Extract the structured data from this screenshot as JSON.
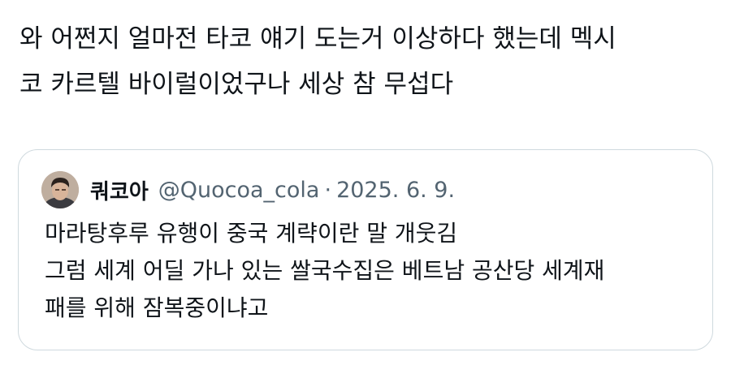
{
  "tweet": {
    "text": "와 어쩐지 얼마전 타코 얘기 도는거 이상하다 했는데 멕시\n코 카르텔 바이럴이었구나 세상 참 무섭다"
  },
  "quote": {
    "author_name": "쿼코아",
    "handle": "@Quocoa_cola",
    "separator": "·",
    "date": "2025. 6. 9.",
    "text": "마라탕후루 유행이 중국 계략이란 말 개웃김\n그럼 세계 어딜 가나 있는 쌀국수집은 베트남 공산당 세계재\n패를 위해 잠복중이냐고"
  },
  "colors": {
    "text_primary": "#0f1419",
    "text_secondary": "#536471",
    "card_border": "#cfd9de"
  }
}
